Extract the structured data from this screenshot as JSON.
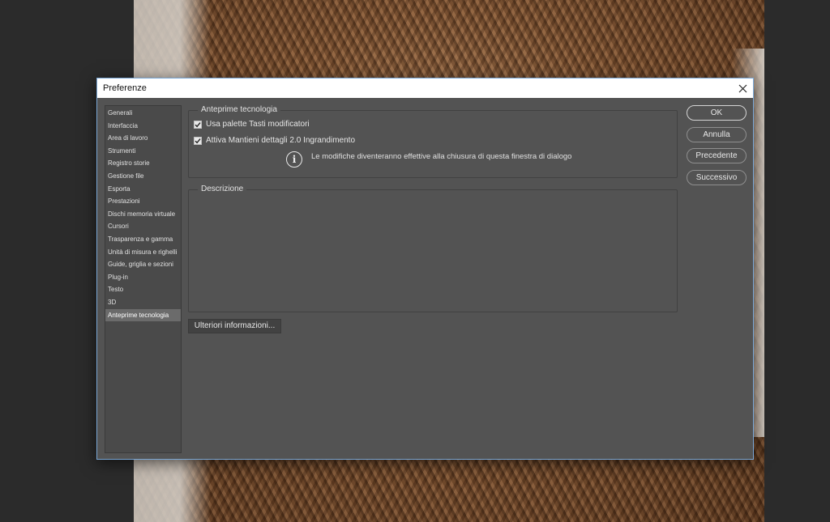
{
  "dialog": {
    "title": "Preferenze"
  },
  "sidebar": {
    "items": [
      {
        "label": "Generali"
      },
      {
        "label": "Interfaccia"
      },
      {
        "label": "Area di lavoro"
      },
      {
        "label": "Strumenti"
      },
      {
        "label": "Registro storie"
      },
      {
        "label": "Gestione file"
      },
      {
        "label": "Esporta"
      },
      {
        "label": "Prestazioni"
      },
      {
        "label": "Dischi memoria virtuale"
      },
      {
        "label": "Cursori"
      },
      {
        "label": "Trasparenza e gamma"
      },
      {
        "label": "Unità di misura e righelli"
      },
      {
        "label": "Guide, griglia e sezioni"
      },
      {
        "label": "Plug-in"
      },
      {
        "label": "Testo"
      },
      {
        "label": "3D"
      },
      {
        "label": "Anteprime tecnologia"
      }
    ],
    "selected_index": 16
  },
  "tech_group": {
    "label": "Anteprime tecnologia",
    "checkbox1": {
      "label": "Usa palette Tasti modificatori",
      "checked": true
    },
    "checkbox2": {
      "label": "Attiva Mantieni dettagli 2.0 Ingrandimento",
      "checked": true
    },
    "info_text": "Le modifiche diventeranno effettive alla chiusura di questa finestra di dialogo"
  },
  "description_group": {
    "label": "Descrizione"
  },
  "buttons": {
    "ok": "OK",
    "cancel": "Annulla",
    "previous": "Precedente",
    "next": "Successivo",
    "more_info": "Ulteriori informazioni..."
  },
  "icons": {
    "close": "close-icon",
    "checkmark": "checkmark-icon",
    "info": "info-icon"
  },
  "colors": {
    "dialog_bg": "#535353",
    "titlebar_bg": "#ffffff",
    "dialog_border": "#7aa7d6",
    "selected_item_bg": "#6b6b6b"
  }
}
